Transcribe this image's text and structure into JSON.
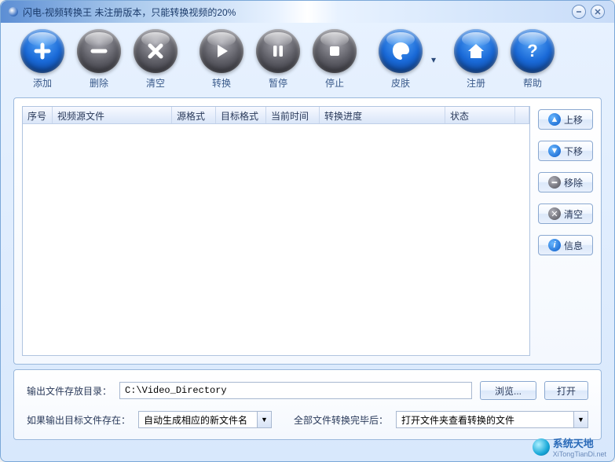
{
  "title": "闪电-视频转换王 未注册版本，只能转换视频的20%",
  "toolbar": {
    "add": "添加",
    "delete": "删除",
    "clear": "清空",
    "convert": "转换",
    "pause": "暂停",
    "stop": "停止",
    "skin": "皮肤",
    "register": "注册",
    "help": "帮助"
  },
  "columns": {
    "index": "序号",
    "source": "视频源文件",
    "src_fmt": "源格式",
    "dst_fmt": "目标格式",
    "time": "当前时间",
    "progress": "转换进度",
    "status": "状态"
  },
  "side": {
    "up": "上移",
    "down": "下移",
    "remove": "移除",
    "clear": "清空",
    "info": "信息"
  },
  "bottom": {
    "output_label": "输出文件存放目录：",
    "output_path": "C:\\Video_Directory",
    "browse": "浏览...",
    "open": "打开",
    "exists_label": "如果输出目标文件存在：",
    "exists_option": "自动生成相应的新文件名",
    "after_label": "全部文件转换完毕后：",
    "after_option": "打开文件夹查看转换的文件"
  },
  "watermark": {
    "text": "系统天地",
    "sub": "XiTongTianDi.net"
  }
}
